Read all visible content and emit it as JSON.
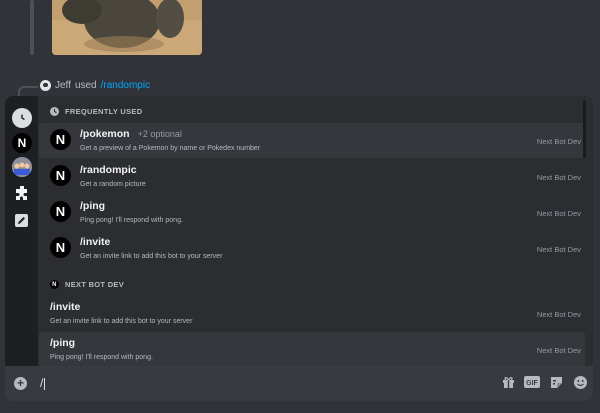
{
  "message": {
    "user": "Jeff",
    "used_text": "used",
    "command": "/randompic"
  },
  "popup": {
    "frequent_header": "FREQUENTLY USED",
    "bot_header": "NEXT BOT DEV",
    "bot_avatar_glyph": "N",
    "frequent": [
      {
        "name": "/pokemon",
        "optional": "+2 optional",
        "desc": "Get a preview of a Pokemon by name or Pokedex number",
        "bot": "Next Bot Dev"
      },
      {
        "name": "/randompic",
        "optional": "",
        "desc": "Get a random picture",
        "bot": "Next Bot Dev"
      },
      {
        "name": "/ping",
        "optional": "",
        "desc": "Ping pong! I'll respond with pong.",
        "bot": "Next Bot Dev"
      },
      {
        "name": "/invite",
        "optional": "",
        "desc": "Get an invite link to add this bot to your server",
        "bot": "Next Bot Dev"
      }
    ],
    "bot_commands": [
      {
        "name": "/invite",
        "desc": "Get an invite link to add this bot to your server",
        "bot": "Next Bot Dev"
      },
      {
        "name": "/ping",
        "desc": "Ping pong! I'll respond with pong.",
        "bot": "Next Bot Dev"
      }
    ]
  },
  "composer": {
    "value": "/"
  },
  "colors": {
    "accent_link": "#00a8fc",
    "background": "#313338",
    "popup": "#2b2d31",
    "rail": "#1e1f22"
  },
  "icons": [
    "clock-icon",
    "next-logo-icon",
    "server-avatar-icon",
    "puzzle-icon",
    "edit-icon",
    "plus-circle-icon",
    "gift-icon",
    "gif-icon",
    "sticker-icon",
    "emoji-icon"
  ]
}
